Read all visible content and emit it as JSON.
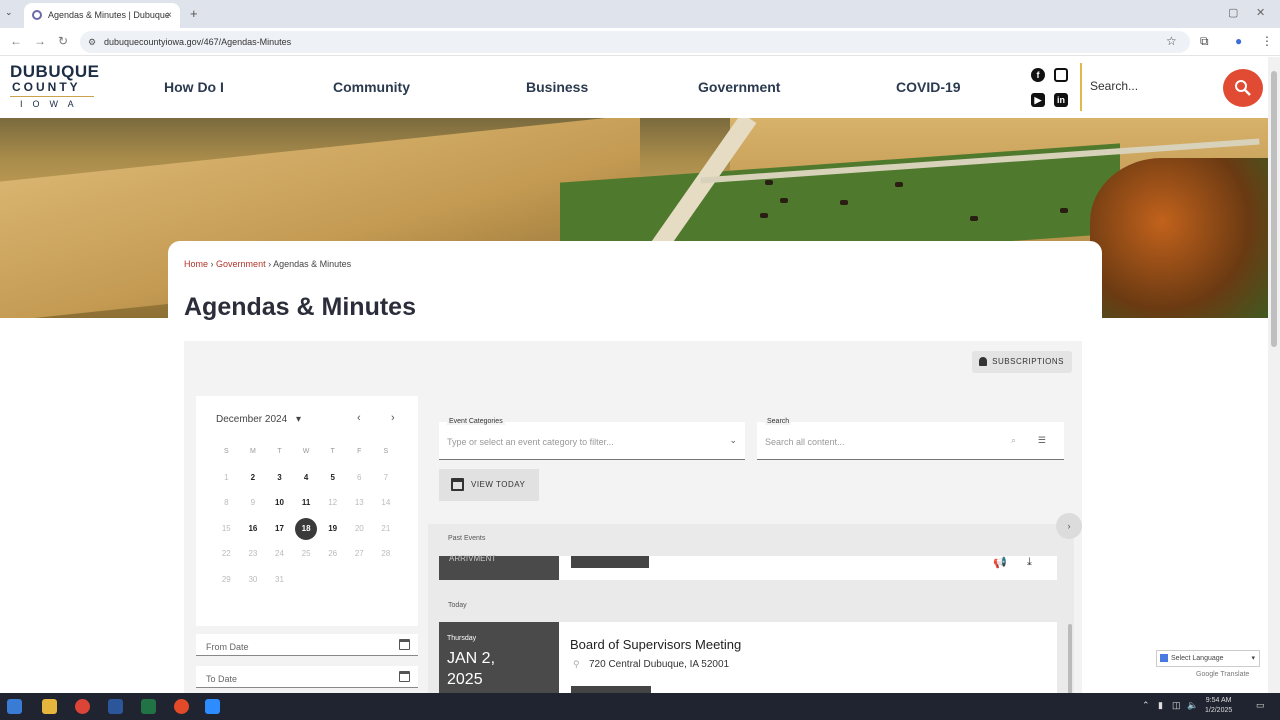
{
  "browser": {
    "tab_title": "Agendas & Minutes | Dubuque",
    "tab_close": "×",
    "new_tab": "+",
    "url": "dubuquecountyiowa.gov/467/Agendas-Minutes"
  },
  "header": {
    "logo_line1": "DUBUQUE",
    "logo_line2": "COUNTY",
    "logo_line3": "IOWA",
    "nav": [
      "How Do I",
      "Community",
      "Business",
      "Government",
      "COVID-19"
    ],
    "search_placeholder": "Search..."
  },
  "breadcrumb": {
    "home": "Home",
    "sep": "›",
    "government": "Government",
    "current": "Agendas & Minutes"
  },
  "page": {
    "title": "Agendas & Minutes",
    "subscriptions": "SUBSCRIPTIONS"
  },
  "calendar": {
    "month": "December 2024",
    "dropdown": "▾",
    "prev": "‹",
    "next": "›",
    "dow": [
      "S",
      "M",
      "T",
      "W",
      "T",
      "F",
      "S"
    ],
    "weeks": [
      [
        "1",
        "2",
        "3",
        "4",
        "5",
        "6",
        "7"
      ],
      [
        "8",
        "9",
        "10",
        "11",
        "12",
        "13",
        "14"
      ],
      [
        "15",
        "16",
        "17",
        "18",
        "19",
        "20",
        "21"
      ],
      [
        "22",
        "23",
        "24",
        "25",
        "26",
        "27",
        "28"
      ],
      [
        "29",
        "30",
        "31",
        "",
        "",
        "",
        ""
      ]
    ],
    "active_days": [
      "2",
      "3",
      "4",
      "5",
      "10",
      "11",
      "16",
      "17",
      "18",
      "19"
    ],
    "selected_day": "18",
    "from_date": "From Date",
    "to_date": "To Date"
  },
  "filters": {
    "category_label": "Event Categories",
    "category_placeholder": "Type or select an event category to filter...",
    "search_label": "Search",
    "search_placeholder": "Search all content...",
    "view_today": "VIEW TODAY"
  },
  "events": {
    "past_label": "Past Events",
    "today_label": "Today",
    "past_card_partial": "ARRIVMENT",
    "today_event": {
      "day": "Thursday",
      "month_day": "JAN 2,",
      "year": "2025",
      "title": "Board of Supervisors Meeting",
      "location": "720 Central Dubuque, IA 52001"
    }
  },
  "translate": {
    "select_language": "Select Language",
    "powered_by": "Google Translate"
  },
  "taskbar": {
    "time": "9:54 AM",
    "date": "1/2/2025"
  }
}
